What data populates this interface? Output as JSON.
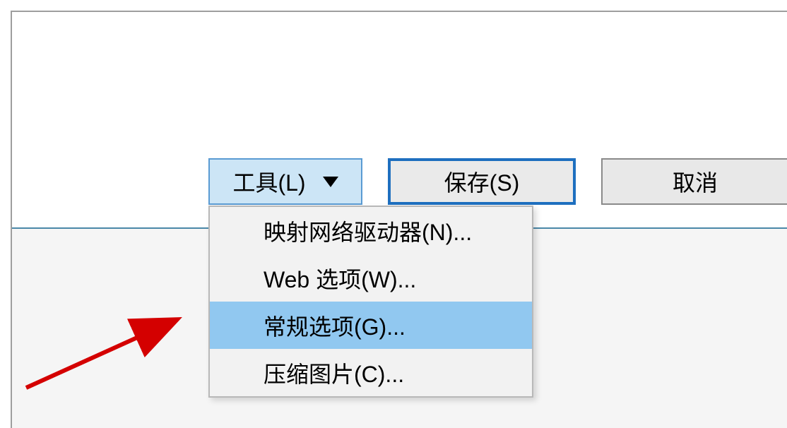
{
  "buttons": {
    "tools": "工具(L)",
    "save": "保存(S)",
    "cancel": "取消"
  },
  "menu": {
    "items": [
      {
        "label": "映射网络驱动器(N)...",
        "selected": false
      },
      {
        "label": "Web 选项(W)...",
        "selected": false
      },
      {
        "label": "常规选项(G)...",
        "selected": true
      },
      {
        "label": "压缩图片(C)...",
        "selected": false
      }
    ]
  },
  "colors": {
    "highlight": "#91c8f0",
    "toolsBg": "#cce5f6",
    "toolsBorder": "#5a9bd3",
    "saveBorder": "#1e6fbf",
    "arrow": "#d40000"
  }
}
